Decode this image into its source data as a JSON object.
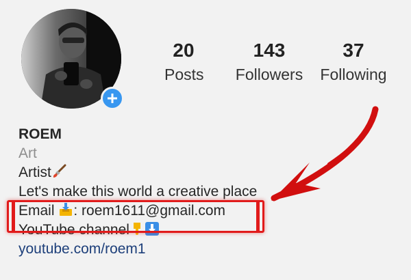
{
  "profile": {
    "name": "ROEM",
    "category": "Art",
    "bio": {
      "line1": "Artist",
      "line2": "Let's make this world a creative place",
      "email_prefix": "Email",
      "email_suffix": ": roem1611@gmail.com",
      "youtube": "YouTube channel",
      "link": "youtube.com/roem1"
    }
  },
  "stats": [
    {
      "value": "20",
      "label": "Posts"
    },
    {
      "value": "143",
      "label": "Followers"
    },
    {
      "value": "37",
      "label": "Following"
    }
  ],
  "icons": {
    "add": "plus-icon",
    "paintbrush": "paintbrush-icon",
    "inbox": "inbox-tray-icon",
    "point_down": "point-down-icon",
    "arrow_down": "arrow-down-icon"
  },
  "colors": {
    "accent": "#3897f0",
    "annotation": "#e11b1b",
    "link": "#1d3f7a"
  }
}
